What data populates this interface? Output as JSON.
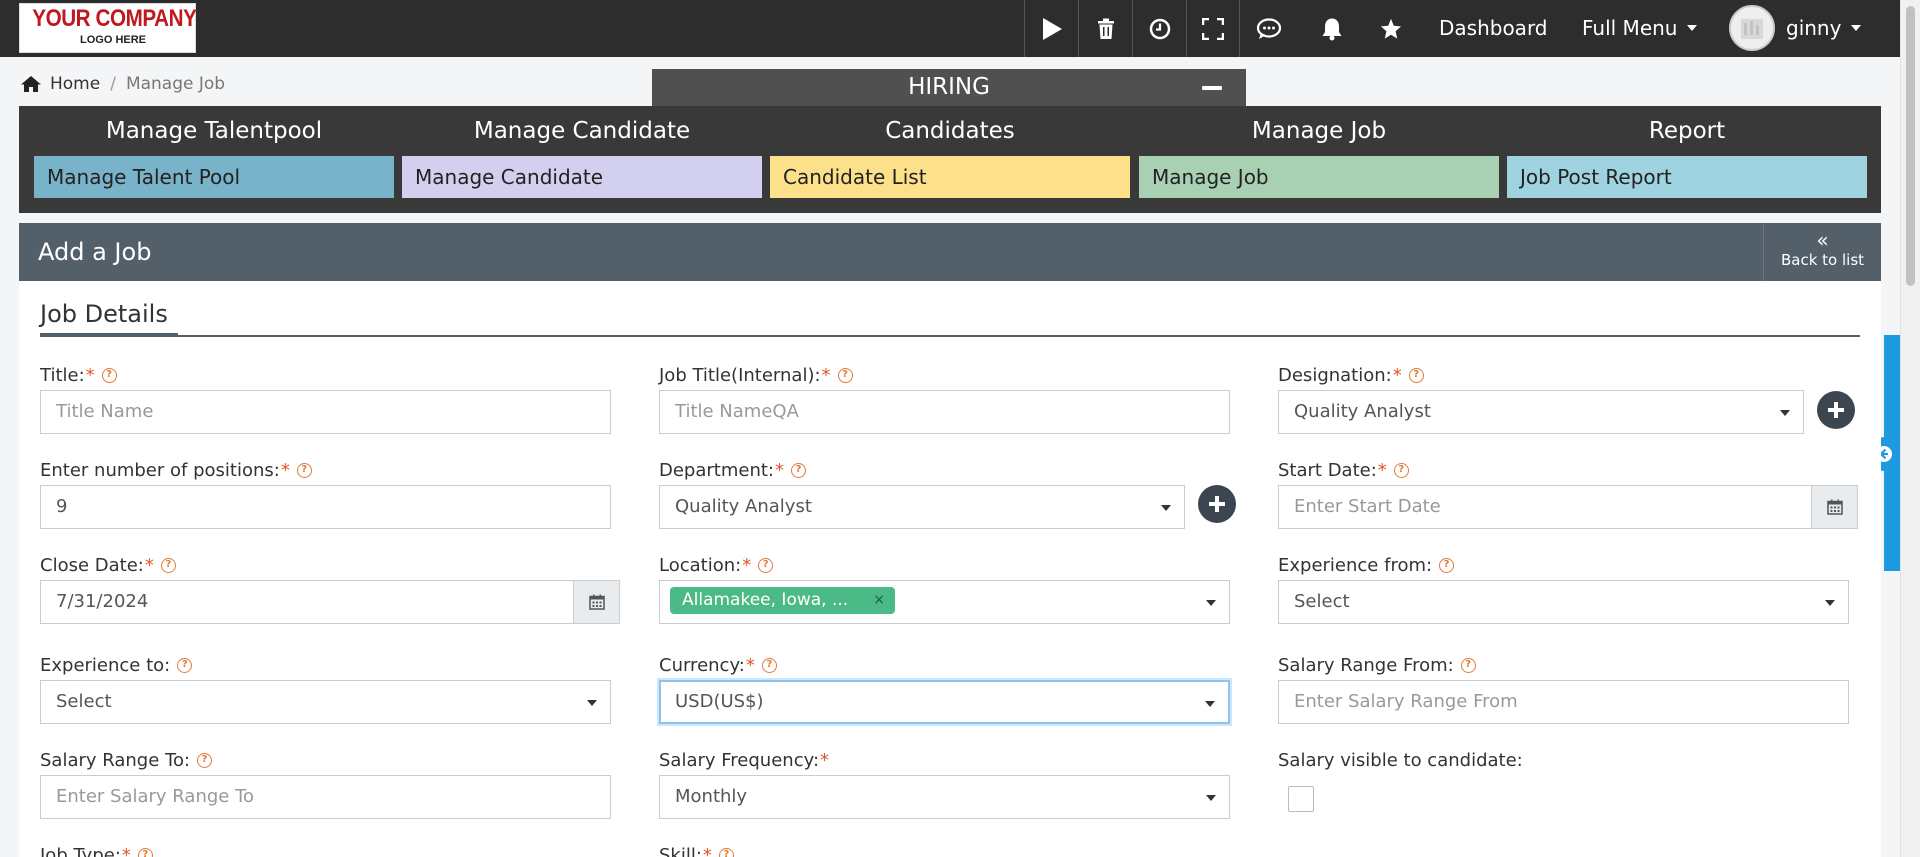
{
  "topbar": {
    "logo_line1": "YOUR COMPANY",
    "logo_line2": "LOGO HERE",
    "icons": [
      "play-icon",
      "trash-icon",
      "clock-icon",
      "fullscreen-icon",
      "chat-icon",
      "bell-icon",
      "star-icon"
    ],
    "dashboard_label": "Dashboard",
    "full_menu_label": "Full Menu",
    "username": "ginny"
  },
  "breadcrumb": {
    "home": "Home",
    "separator": "/",
    "current": "Manage Job"
  },
  "hiring": {
    "title": "HIRING",
    "columns": [
      {
        "title": "Manage Talentpool",
        "button": "Manage Talent Pool",
        "color": "#79b3c9"
      },
      {
        "title": "Manage Candidate",
        "button": "Manage Candidate",
        "color": "#d3cfef"
      },
      {
        "title": "Candidates",
        "button": "Candidate List",
        "color": "#fde08a"
      },
      {
        "title": "Manage Job",
        "button": "Manage Job",
        "color": "#a8d0b2"
      },
      {
        "title": "Report",
        "button": "Job Post Report",
        "color": "#9fd3e0"
      }
    ]
  },
  "card": {
    "title": "Add a Job",
    "back_arrow": "«",
    "back_label": "Back to list",
    "section_title": "Job Details"
  },
  "form": {
    "title": {
      "label": "Title:",
      "required": "*",
      "placeholder": "Title Name"
    },
    "job_title_internal": {
      "label": "Job Title(Internal):",
      "required": "*",
      "placeholder": "Title NameQA"
    },
    "designation": {
      "label": "Designation:",
      "required": "*",
      "value": "Quality Analyst"
    },
    "positions": {
      "label": "Enter number of positions:",
      "required": "*",
      "value": "9"
    },
    "department": {
      "label": "Department:",
      "required": "*",
      "value": "Quality Analyst"
    },
    "start_date": {
      "label": "Start Date:",
      "required": "*",
      "placeholder": "Enter Start Date"
    },
    "close_date": {
      "label": "Close Date:",
      "required": "*",
      "value": "7/31/2024"
    },
    "location": {
      "label": "Location:",
      "required": "*",
      "tag": "Allamakee, Iowa, ...",
      "tag_remove": "×"
    },
    "experience_from": {
      "label": "Experience from:",
      "value": "Select"
    },
    "experience_to": {
      "label": "Experience to:",
      "value": "Select"
    },
    "currency": {
      "label": "Currency:",
      "required": "*",
      "value": "USD(US$)"
    },
    "salary_from": {
      "label": "Salary Range From:",
      "placeholder": "Enter Salary Range From"
    },
    "salary_to": {
      "label": "Salary Range To:",
      "placeholder": "Enter Salary Range To"
    },
    "salary_frequency": {
      "label": "Salary Frequency:",
      "required": "*",
      "value": "Monthly"
    },
    "salary_visible": {
      "label": "Salary visible to candidate:",
      "checked": false
    },
    "job_type": {
      "label": "Job Type:",
      "required": "*"
    },
    "skill": {
      "label": "Skill:",
      "required": "*"
    },
    "help_glyph": "?"
  }
}
